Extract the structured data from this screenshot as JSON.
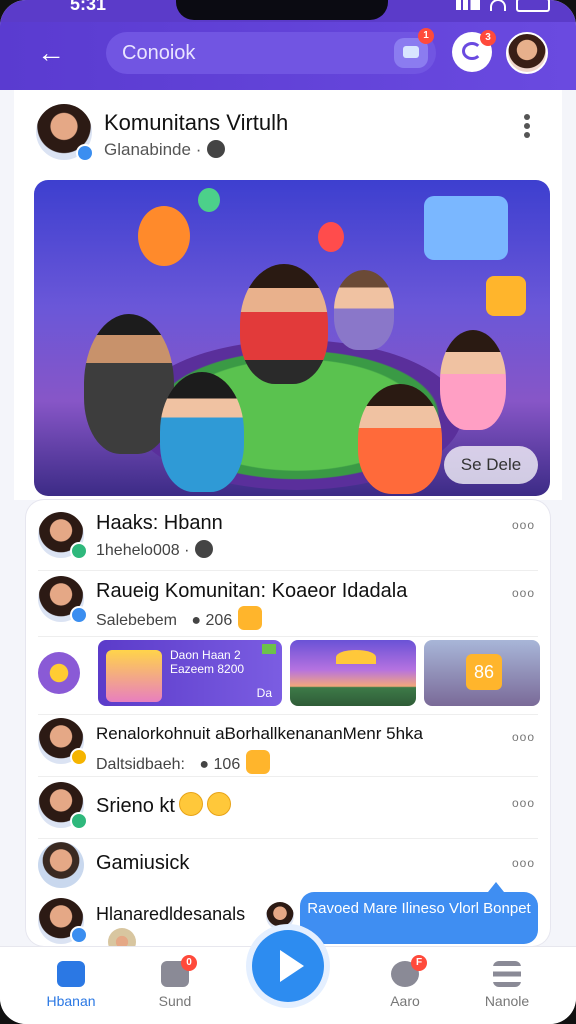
{
  "status": {
    "time": "5:31"
  },
  "header": {
    "search_text": "Conoiok",
    "chat_badge": "1",
    "notif_badge": "3"
  },
  "post": {
    "title": "Komunitans Virtulh",
    "subtitle": "Glanabinde",
    "see_button": "Se Dele"
  },
  "feed": {
    "items": [
      {
        "title": "Haaks: Hbann",
        "sub": "1hehelo008"
      },
      {
        "title": "Raueig Komunitan: Koaeor Idadala",
        "sub": "Salebebem",
        "count": "206"
      },
      {
        "thumb1_text": "Daon Haan 2\nEazeem 8200",
        "thumb1_sub": "Da",
        "thumb3_label": "86"
      },
      {
        "title": "Renalorkohnuit aBorhallkenananMenr 5hka",
        "sub": "Daltsidbaeh:",
        "count": "106"
      },
      {
        "title": "Srieno kt"
      },
      {
        "title": "Gamiusick"
      },
      {
        "title": "Hlanaredldesanals"
      }
    ]
  },
  "toast": {
    "text": "Ravoed Mare Ilineso Vlorl Bonpet"
  },
  "nav": {
    "home": "Hbanan",
    "send": "Sund",
    "aaro": "Aaro",
    "more": "Nanole",
    "send_badge": "0",
    "aaro_badge": "F"
  },
  "colors": {
    "accent": "#5b3bc9",
    "primary_blue": "#2d8cf0"
  }
}
